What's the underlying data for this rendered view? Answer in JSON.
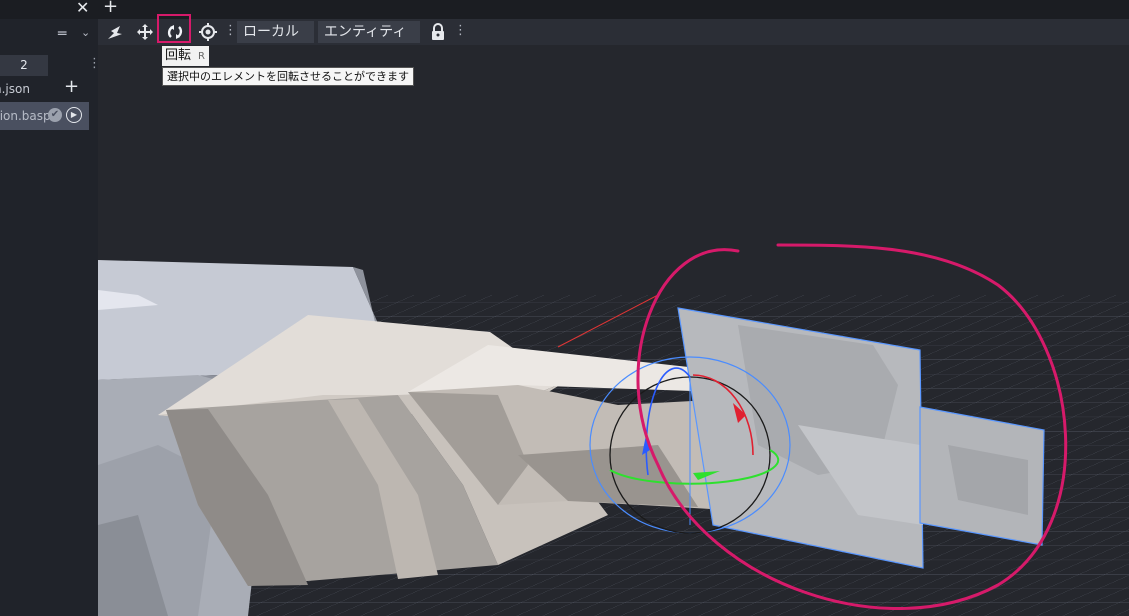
{
  "sidebar": {
    "close_icon": "close-icon",
    "menu_icon": "menu-lines-icon",
    "tab_label": "2",
    "files": [
      {
        "label": "n.json"
      },
      {
        "label": "tion.basp"
      }
    ]
  },
  "toolbar": {
    "icons": [
      "pivot-tool-icon",
      "move-icon",
      "rotate-icon",
      "locate-icon",
      "lock-icon"
    ],
    "space_dropdown": "ローカル",
    "mode_dropdown": "エンティティ"
  },
  "tooltip": {
    "title": "回転",
    "shortcut": "R",
    "description": "選択中のエレメントを回転させることができます"
  },
  "colors": {
    "highlight": "#d61a6a",
    "gizmo_x": "#e02030",
    "gizmo_y": "#2ee02e",
    "gizmo_z": "#2a5cff",
    "selection": "#5aa0ff"
  }
}
